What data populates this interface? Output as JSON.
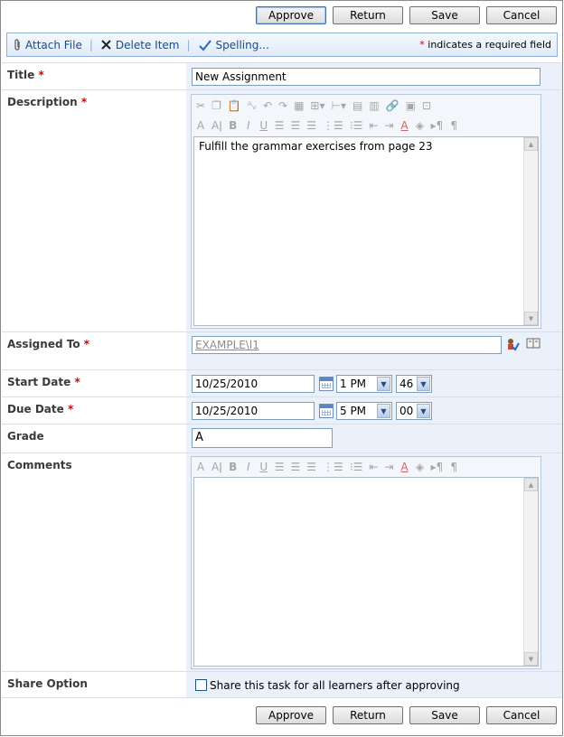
{
  "buttons": {
    "approve": "Approve",
    "return": "Return",
    "save": "Save",
    "cancel": "Cancel"
  },
  "toolbar": {
    "attach_file": "Attach File",
    "delete_item": "Delete Item",
    "spelling": "Spelling...",
    "required_note": "indicates a required field"
  },
  "fields": {
    "title": {
      "label": "Title",
      "value": "New Assignment"
    },
    "description": {
      "label": "Description",
      "value": "Fulfill the grammar exercises from page 23"
    },
    "assigned_to": {
      "label": "Assigned To",
      "value": "EXAMPLE\\l1"
    },
    "start_date": {
      "label": "Start Date",
      "date": "10/25/2010",
      "hour": "1 PM",
      "minute": "46"
    },
    "due_date": {
      "label": "Due Date",
      "date": "10/25/2010",
      "hour": "5 PM",
      "minute": "00"
    },
    "grade": {
      "label": "Grade",
      "value": "A"
    },
    "comments": {
      "label": "Comments",
      "value": ""
    },
    "share_option": {
      "label": "Share Option",
      "checkbox_label": "Share this task for all learners after approving",
      "checked": false
    }
  },
  "required_marker": "*",
  "colors": {
    "field_bg": "#eaf1fb",
    "required": "#d40000",
    "link": "#1b4a8a"
  }
}
